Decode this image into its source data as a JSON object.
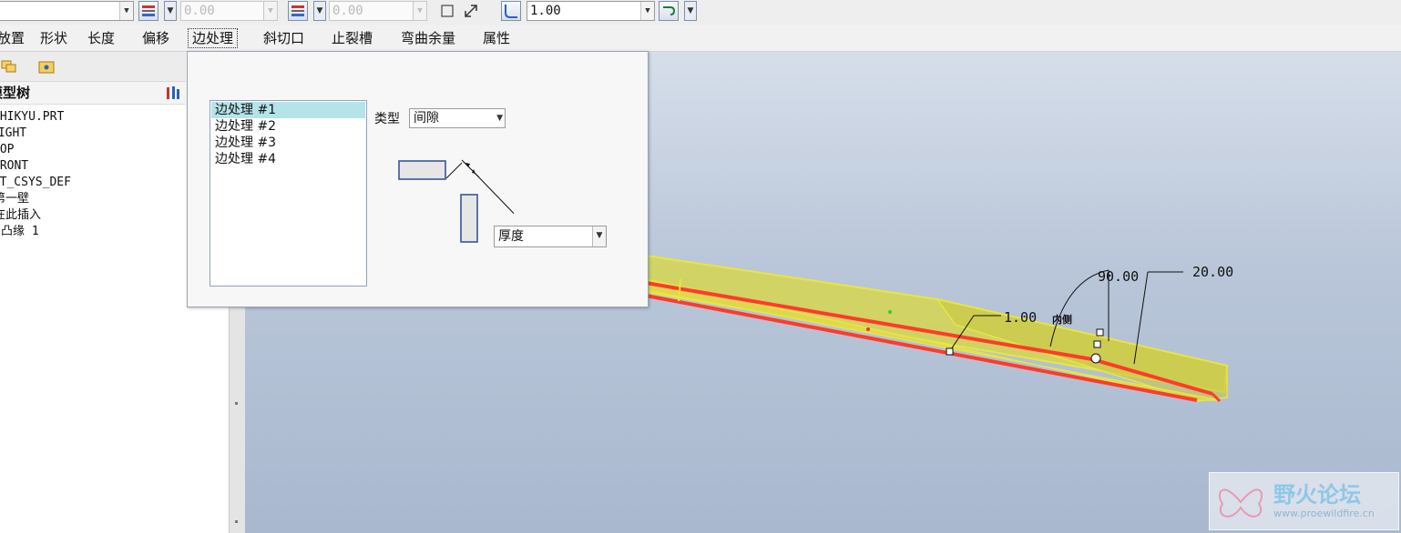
{
  "toolbar": {
    "combo1_value": "",
    "offset1_value": "0.00",
    "offset2_value": "0.00",
    "radius_value": "1.00"
  },
  "tabs": [
    "放置",
    "形状",
    "长度",
    "偏移",
    "边处理",
    "斜切口",
    "止裂槽",
    "弯曲余量",
    "属性"
  ],
  "active_tab": "边处理",
  "model_tree": {
    "header": "模型树",
    "items": [
      "WHIKYU.PRT",
      "RIGHT",
      "TOP",
      "FRONT",
      "PRT_CSYS_DEF",
      "第一壁",
      "在此插入",
      "凸缘 1"
    ]
  },
  "dialog": {
    "edge_treatments": [
      "边处理 #1",
      "边处理 #2",
      "边处理 #3",
      "边处理 #4"
    ],
    "selected_edge": "边处理 #1",
    "type_label": "类型",
    "type_value": "间隙",
    "thickness_value": "厚度"
  },
  "viewport": {
    "dim_thickness": "1.00",
    "dim_angle": "90.00",
    "dim_length": "20.00",
    "side_label": "内侧"
  },
  "watermark": {
    "title": "野火论坛",
    "url": "www.proewildfire.cn"
  },
  "colors": {
    "part_yellow": "#e8e640",
    "edge_red": "#ff3b2a",
    "selection_cyan": "#b4e4e8"
  }
}
